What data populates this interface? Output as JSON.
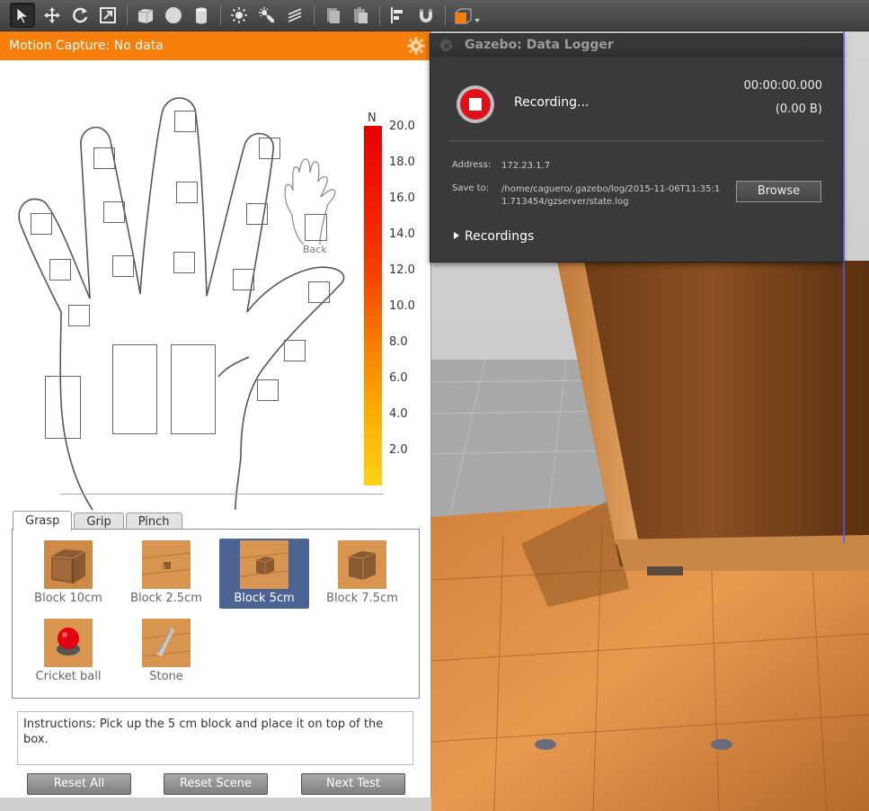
{
  "toolbar": {
    "buttons": [
      "select-mode",
      "translate-mode",
      "rotate-mode",
      "scale-mode",
      "box-shape",
      "sphere-shape",
      "cylinder-shape",
      "point-light",
      "spot-light",
      "directional-light",
      "copy",
      "paste",
      "align",
      "snap",
      "view-angle"
    ]
  },
  "panel": {
    "title": "Motion Capture: No data",
    "back_label": "Back",
    "unit": "N",
    "scale_ticks": [
      "20.0",
      "18.0",
      "16.0",
      "14.0",
      "12.0",
      "10.0",
      "8.0",
      "6.0",
      "4.0",
      "2.0"
    ],
    "colors": {
      "header": "#f57f0a",
      "selected": "#4c6494"
    }
  },
  "tabs": [
    {
      "label": "Grasp",
      "active": true
    },
    {
      "label": "Grip",
      "active": false
    },
    {
      "label": "Pinch",
      "active": false
    }
  ],
  "objects": [
    {
      "label": "Block 10cm",
      "thumb": "big-cube"
    },
    {
      "label": "Block 2.5cm",
      "thumb": "small-cube"
    },
    {
      "label": "Block 5cm",
      "thumb": "medium-cube",
      "selected": true
    },
    {
      "label": "Block 7.5cm",
      "thumb": "large-cube"
    },
    {
      "label": "Cricket ball",
      "thumb": "red-ball"
    },
    {
      "label": "Stone",
      "thumb": "stone"
    }
  ],
  "instructions": "Instructions: Pick up the 5 cm block and place it on top of the box.",
  "buttons": {
    "reset_all": "Reset All",
    "reset_scene": "Reset Scene",
    "next_test": "Next Test"
  },
  "logger": {
    "title": "Gazebo: Data Logger",
    "status": "Recording...",
    "time": "00:00:00.000",
    "size": "(0.00 B)",
    "address_label": "Address:",
    "address": "172.23.1.7",
    "save_label": "Save to:",
    "save_path_line1": "/home/caguero/.gazebo/log/2015-11-06T11:35:1",
    "save_path_line2": "1.713454/gzserver/state.log",
    "browse": "Browse",
    "recordings": "Recordings"
  }
}
